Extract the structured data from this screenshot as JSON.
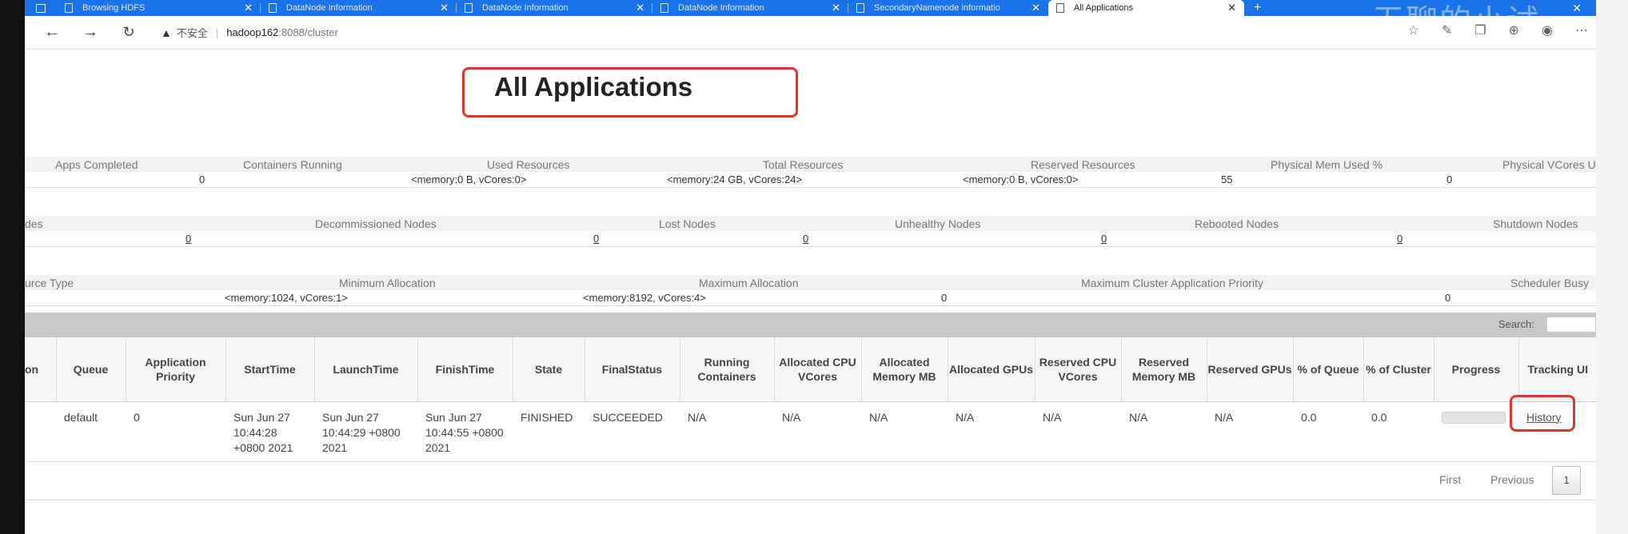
{
  "browser": {
    "tabs": [
      {
        "title": "Browsing HDFS"
      },
      {
        "title": "DataNode Information"
      },
      {
        "title": "DataNode Information"
      },
      {
        "title": "DataNode Information"
      },
      {
        "title": "SecondaryNamenode informatio"
      },
      {
        "title": "All Applications"
      }
    ],
    "watermark": "无聊的小试",
    "insecure_label": "不安全",
    "url_host": "hadoop162",
    "url_path": ":8088/cluster"
  },
  "page": {
    "title": "All Applications"
  },
  "cluster_metrics": {
    "headers": [
      "Apps Completed",
      "Containers Running",
      "Used Resources",
      "Total Resources",
      "Reserved Resources",
      "Physical Mem Used %",
      "Physical VCores U"
    ],
    "values": [
      "0",
      "<memory:0 B, vCores:0>",
      "<memory:24 GB, vCores:24>",
      "<memory:0 B, vCores:0>",
      "55",
      "0"
    ]
  },
  "node_metrics": {
    "headers": [
      "des",
      "Decommissioned Nodes",
      "Lost Nodes",
      "Unhealthy Nodes",
      "Rebooted Nodes",
      "Shutdown Nodes"
    ],
    "values": [
      "0",
      "0",
      "0",
      "0",
      "0"
    ]
  },
  "scheduler_metrics": {
    "headers": [
      "urce Type",
      "Minimum Allocation",
      "Maximum Allocation",
      "Maximum Cluster Application Priority",
      "Scheduler Busy"
    ],
    "values": [
      "<memory:1024, vCores:1>",
      "<memory:8192, vCores:4>",
      "0",
      "0"
    ]
  },
  "search_label": "Search:",
  "table": {
    "columns": [
      "on",
      "Queue",
      "Application Priority",
      "StartTime",
      "LaunchTime",
      "FinishTime",
      "State",
      "FinalStatus",
      "Running Containers",
      "Allocated CPU VCores",
      "Allocated Memory MB",
      "Allocated GPUs",
      "Reserved CPU VCores",
      "Reserved Memory MB",
      "Reserved GPUs",
      "% of Queue",
      "% of Cluster",
      "Progress",
      "Tracking UI"
    ],
    "rows": [
      {
        "name": "",
        "queue": "default",
        "priority": "0",
        "start": "Sun Jun 27 10:44:28 +0800 2021",
        "launch": "Sun Jun 27 10:44:29 +0800 2021",
        "finish": "Sun Jun 27 10:44:55 +0800 2021",
        "state": "FINISHED",
        "final_status": "SUCCEEDED",
        "running_containers": "N/A",
        "alloc_cpu": "N/A",
        "alloc_mem": "N/A",
        "alloc_gpu": "N/A",
        "res_cpu": "N/A",
        "res_mem": "N/A",
        "res_gpu": "N/A",
        "pct_queue": "0.0",
        "pct_cluster": "0.0",
        "progress": 0,
        "tracking": "History"
      }
    ]
  },
  "pager": {
    "first": "First",
    "previous": "Previous",
    "page": "1"
  }
}
